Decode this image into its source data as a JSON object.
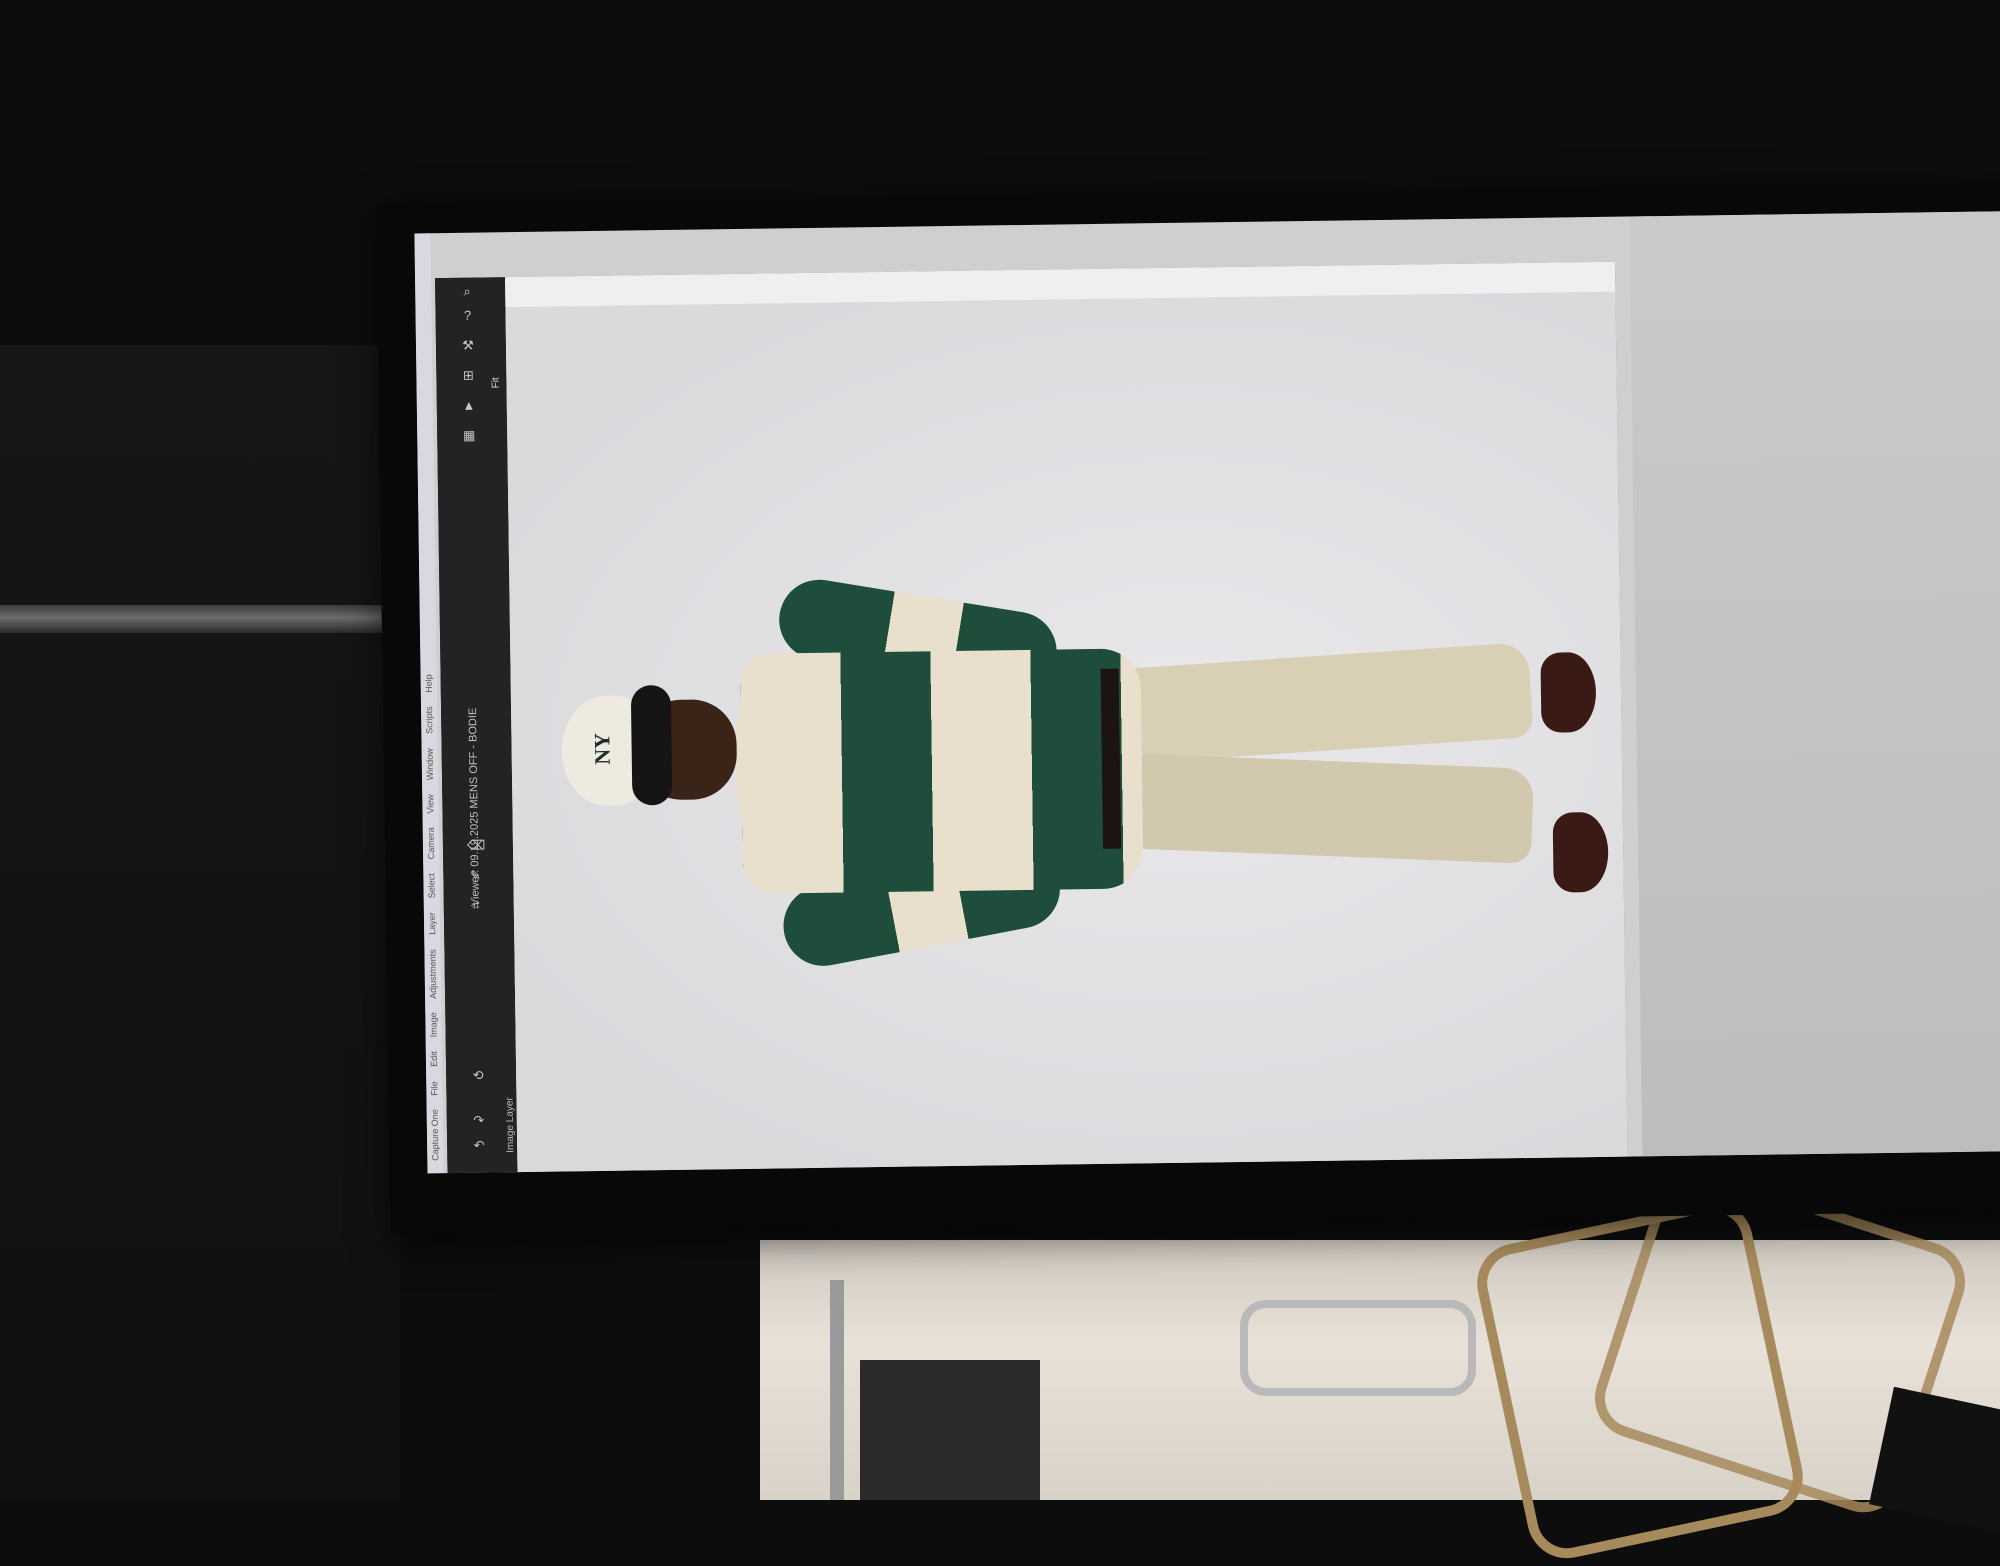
{
  "menubar": {
    "items": [
      "Capture One",
      "File",
      "Edit",
      "Image",
      "Adjustments",
      "Layer",
      "Select",
      "Camera",
      "View",
      "Window",
      "Scripts",
      "Help"
    ]
  },
  "document": {
    "file_name": "Viewer: 09.19.2025 MENS OFF - BODIE",
    "layer_label": "Image Layer",
    "zoom_label": "Fit"
  },
  "photo": {
    "cap_logo": "NY"
  },
  "colors": {
    "sweater_green": "#1e4d3c",
    "sweater_cream": "#e8e0cc",
    "pants": "#d8cfb4",
    "app_dark": "#1c1c1c"
  }
}
